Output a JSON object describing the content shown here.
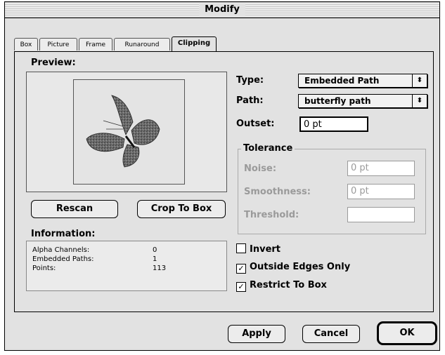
{
  "window": {
    "title": "Modify"
  },
  "tabs": [
    {
      "label": "Box"
    },
    {
      "label": "Picture"
    },
    {
      "label": "Frame"
    },
    {
      "label": "Runaround"
    },
    {
      "label": "Clipping"
    }
  ],
  "active_tab": "Clipping",
  "preview": {
    "label": "Preview:"
  },
  "buttons": {
    "rescan": "Rescan",
    "crop_to_box": "Crop To Box",
    "apply": "Apply",
    "cancel": "Cancel",
    "ok": "OK"
  },
  "information": {
    "label": "Information:",
    "rows": [
      {
        "key": "Alpha Channels:",
        "value": "0"
      },
      {
        "key": "Embedded Paths:",
        "value": "1"
      },
      {
        "key": "Points:",
        "value": "113"
      }
    ]
  },
  "type": {
    "label": "Type:",
    "value": "Embedded Path"
  },
  "path": {
    "label": "Path:",
    "value": "butterfly path"
  },
  "outset": {
    "label": "Outset:",
    "value": "0 pt"
  },
  "tolerance": {
    "title": "Tolerance",
    "noise": {
      "label": "Noise:",
      "value": "0 pt"
    },
    "smoothness": {
      "label": "Smoothness:",
      "value": "0 pt"
    },
    "threshold": {
      "label": "Threshold:",
      "value": ""
    }
  },
  "options": {
    "invert": {
      "label": "Invert",
      "checked": false
    },
    "outside_edges_only": {
      "label": "Outside Edges Only",
      "checked": true
    },
    "restrict_to_box": {
      "label": "Restrict To Box",
      "checked": true
    }
  }
}
